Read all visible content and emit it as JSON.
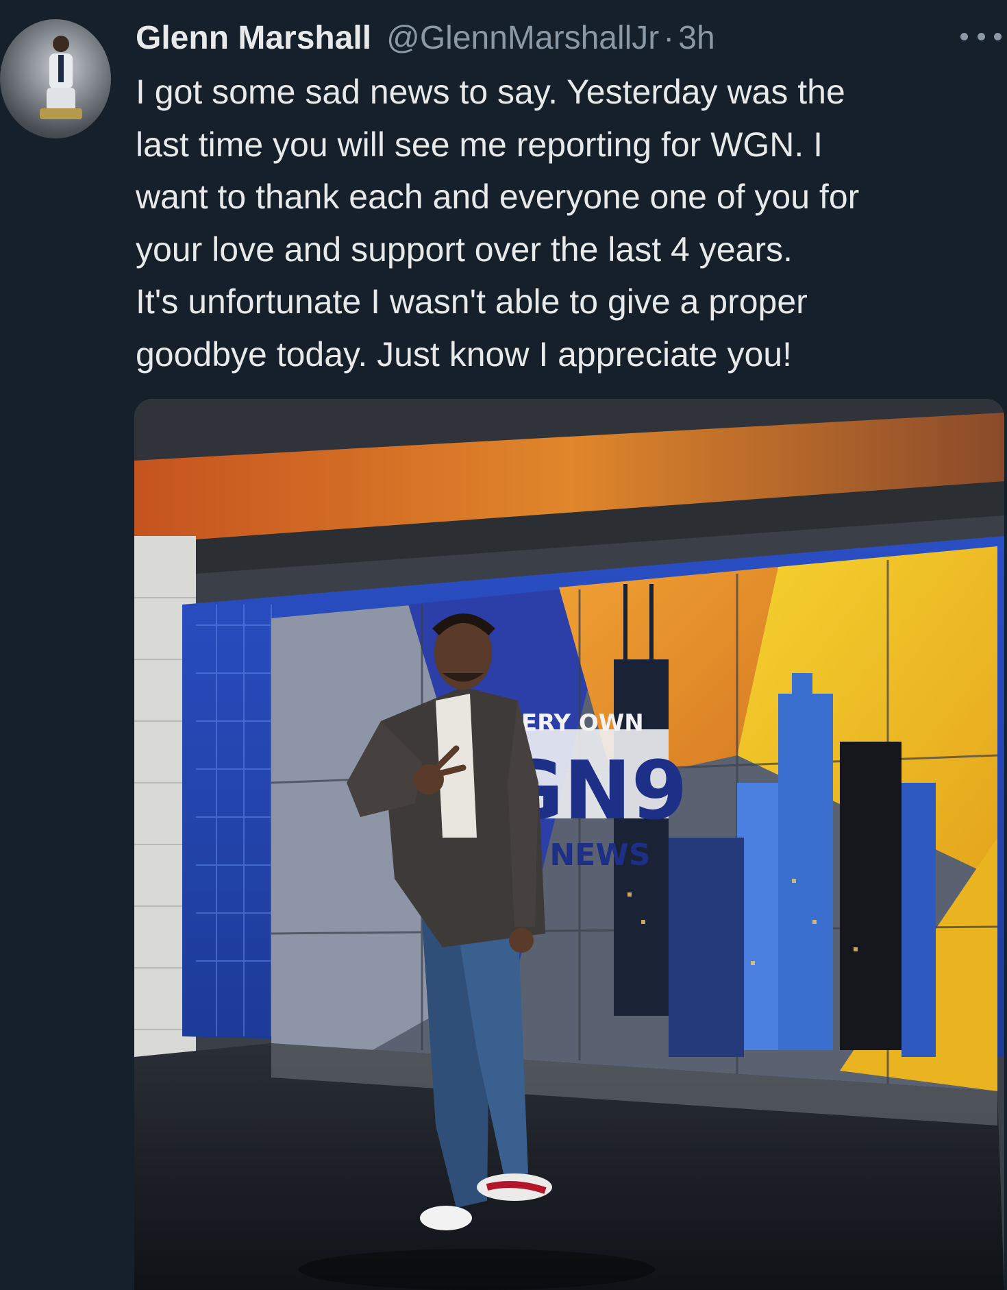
{
  "tweet": {
    "author": {
      "display_name": "Glenn Marshall",
      "handle": "@GlennMarshallJr",
      "separator": "·",
      "time": "3h",
      "avatar_icon": "profile-photo-avatar"
    },
    "more_icon": "ellipsis-icon",
    "text_lines": [
      "I got some sad news to say. Yesterday was the",
      "last time you will see me reporting for WGN. I",
      "want to thank each and everyone one of you for",
      "your love and support over the last 4 years.",
      "It's unfortunate I wasn't able to give a proper",
      "goodbye today. Just know I appreciate you!"
    ],
    "media": {
      "description_icon": "news-studio-photo",
      "signage": {
        "line1": "CHI   O'S VERY OWN",
        "logo": "GN9",
        "line3": "G NEWS"
      }
    }
  },
  "colors": {
    "background": "#15202b",
    "text_primary": "#e7e9ea",
    "text_secondary": "#8b98a5"
  }
}
